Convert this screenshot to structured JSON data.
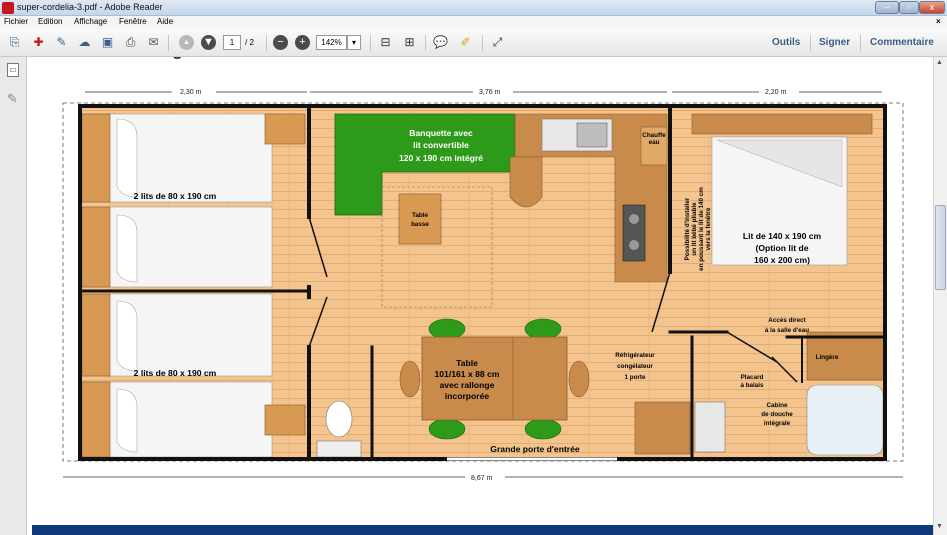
{
  "window": {
    "title": "super-cordelia-3.pdf - Adobe Reader",
    "controls": {
      "minimize": "–",
      "maximize": "▫",
      "close": "x"
    },
    "close_doc": "×"
  },
  "menu": [
    "Fichier",
    "Edition",
    "Affichage",
    "Fenêtre",
    "Aide"
  ],
  "toolbar": {
    "page_current": "1",
    "page_total": "/ 2",
    "zoom": "142%",
    "zoom_arrow": "▾",
    "links": [
      "Outils",
      "Signer",
      "Commentaire"
    ]
  },
  "colors": {
    "floor": "#f3c48d",
    "banquette": "#2e9a1a",
    "wall": "#111111",
    "cabinet": "#c98b4b",
    "titlebar": "#c5d6ea",
    "accent": "#3a5d86"
  },
  "plan": {
    "dimensions": {
      "left": "2,30 m",
      "middle": "3,76 m",
      "right": "2,20 m",
      "total": "8,67 m"
    },
    "labels": {
      "beds_top": "2 lits de 80 x 190 cm",
      "beds_bottom": "2 lits de 80 x 190 cm",
      "banquette": [
        "Banquette avec",
        "lit convertible",
        "120 x 190 cm intégré"
      ],
      "table_basse": [
        "Table",
        "basse"
      ],
      "chauffe_eau": [
        "Chauffe",
        "eau"
      ],
      "possibilite": [
        "Possibilité d'installer",
        "un lit bébé pliable",
        "en poussant le lit de 140 cm",
        "vers la fenêtre"
      ],
      "master_bed": [
        "Lit de 140 x 190 cm",
        "(Option lit de",
        "160 x 200 cm)"
      ],
      "acces": [
        "Accès direct",
        "à la salle d'eau"
      ],
      "lingerie": "Lingère",
      "frigo": [
        "Réfrigérateur",
        "congélateur",
        "1 porte"
      ],
      "placard": [
        "Placard",
        "à balais"
      ],
      "douche": [
        "Cabine",
        "de douche",
        "intégrale"
      ],
      "table": [
        "Table",
        "101/161 x 88 cm",
        "avec rallonge",
        "incorporée"
      ],
      "entrance": "Grande porte d'entrée"
    }
  }
}
